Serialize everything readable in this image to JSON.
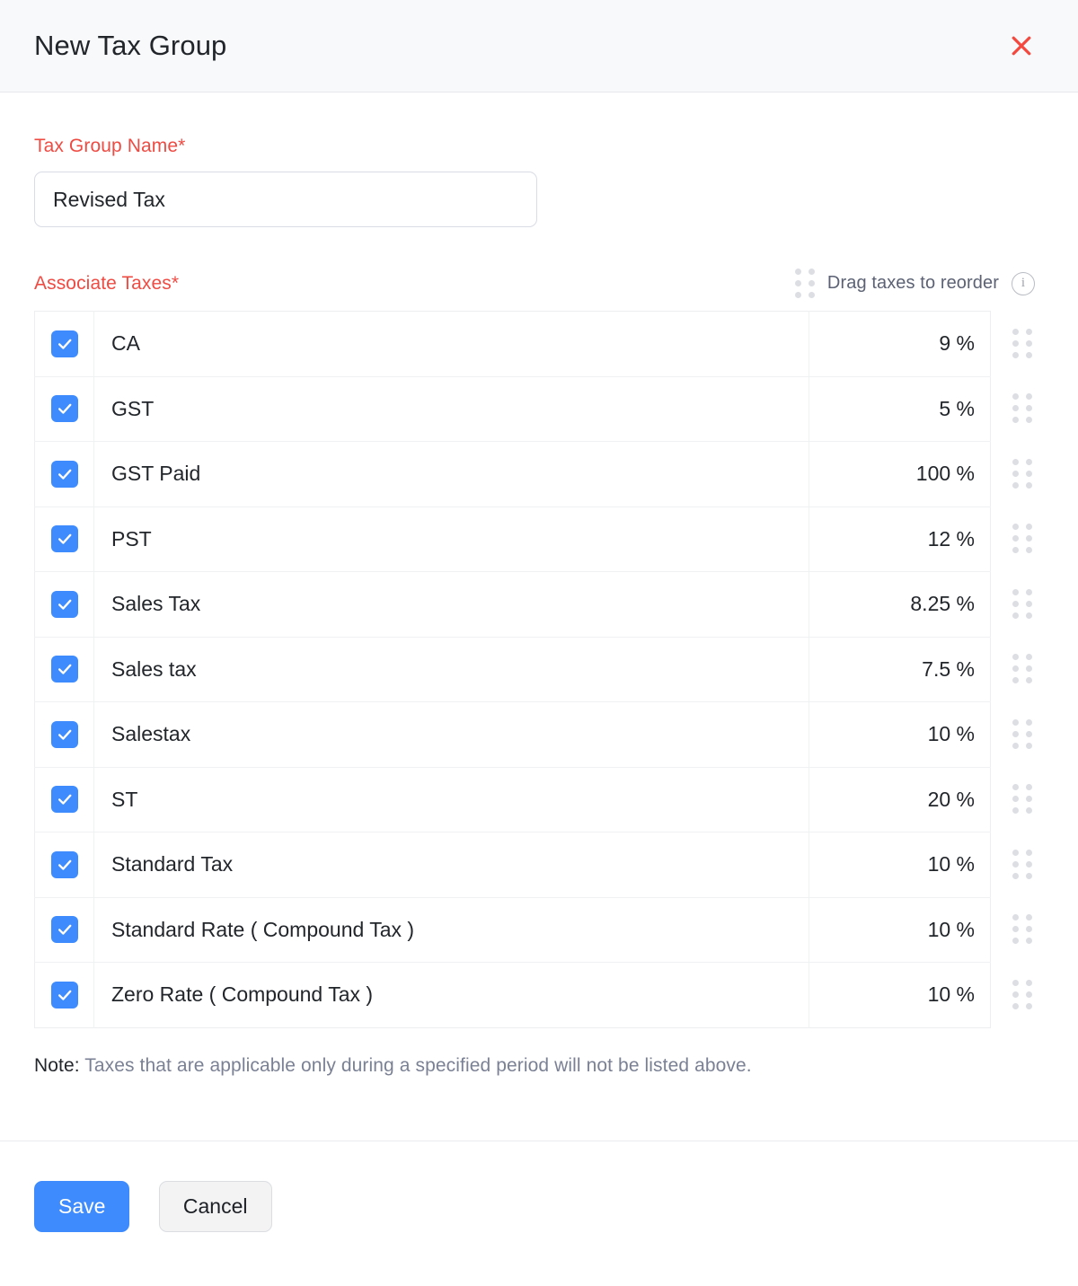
{
  "header": {
    "title": "New Tax Group",
    "close_icon": "close-icon",
    "close_color": "#f4483f"
  },
  "form": {
    "name_label": "Tax Group Name*",
    "name_value": "Revised Tax",
    "name_placeholder": "Tax Group Name"
  },
  "associate": {
    "label": "Associate Taxes*",
    "reorder_text": "Drag taxes to reorder",
    "drag_icon": "drag-handle-icon",
    "info_icon": "info-icon",
    "info_glyph": "i"
  },
  "taxes": [
    {
      "name": "CA",
      "rate": "9 %",
      "checked": true
    },
    {
      "name": "GST",
      "rate": "5 %",
      "checked": true
    },
    {
      "name": "GST Paid",
      "rate": "100 %",
      "checked": true
    },
    {
      "name": "PST",
      "rate": "12 %",
      "checked": true
    },
    {
      "name": "Sales Tax",
      "rate": "8.25 %",
      "checked": true
    },
    {
      "name": "Sales tax",
      "rate": "7.5 %",
      "checked": true
    },
    {
      "name": "Salestax",
      "rate": "10 %",
      "checked": true
    },
    {
      "name": "ST",
      "rate": "20 %",
      "checked": true
    },
    {
      "name": "Standard Tax",
      "rate": "10 %",
      "checked": true
    },
    {
      "name": "Standard Rate ( Compound Tax )",
      "rate": "10 %",
      "checked": true
    },
    {
      "name": "Zero Rate ( Compound Tax )",
      "rate": "10 %",
      "checked": true
    }
  ],
  "note": {
    "label": "Note:",
    "text": " Taxes that are applicable only during a specified period will not be listed above."
  },
  "footer": {
    "save_label": "Save",
    "cancel_label": "Cancel",
    "save_color": "#3d8bfd"
  }
}
